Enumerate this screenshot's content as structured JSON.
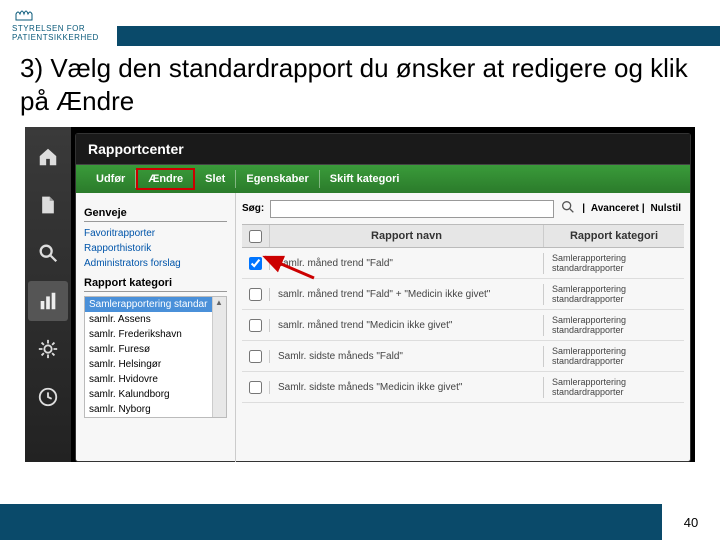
{
  "logo": {
    "line1": "STYRELSEN FOR",
    "line2": "PATIENTSIKKERHED"
  },
  "slide_title": "3) Vælg den standardrapport du ønsker at redigere og klik på Ændre",
  "panel_title": "Rapportcenter",
  "toolbar": {
    "udfor": "Udfør",
    "aendre": "Ændre",
    "slet": "Slet",
    "egenskaber": "Egenskaber",
    "skift": "Skift kategori"
  },
  "sidebar": {
    "genveje_head": "Genveje",
    "links": [
      "Favoritrapporter",
      "Rapporthistorik",
      "Administrators forslag"
    ],
    "kategori_head": "Rapport kategori",
    "categories": [
      "Samlerapportering standar",
      "samlr. Assens",
      "samlr. Frederikshavn",
      "samlr. Furesø",
      "samlr. Helsingør",
      "samlr. Hvidovre",
      "samlr. Kalundborg",
      "samlr. Nyborg"
    ]
  },
  "search": {
    "label": "Søg:",
    "advanced": "Avanceret",
    "reset": "Nulstil"
  },
  "grid": {
    "col_name": "Rapport navn",
    "col_cat": "Rapport kategori",
    "rows": [
      {
        "name": "samlr. måned trend \"Fald\"",
        "cat": "Samlerapportering standardrapporter",
        "checked": true
      },
      {
        "name": "samlr. måned trend \"Fald\" + \"Medicin ikke givet\"",
        "cat": "Samlerapportering standardrapporter",
        "checked": false
      },
      {
        "name": "samlr. måned trend \"Medicin ikke givet\"",
        "cat": "Samlerapportering standardrapporter",
        "checked": false
      },
      {
        "name": "Samlr. sidste måneds \"Fald\"",
        "cat": "Samlerapportering standardrapporter",
        "checked": false
      },
      {
        "name": "Samlr. sidste måneds \"Medicin ikke givet\"",
        "cat": "Samlerapportering standardrapporter",
        "checked": false
      }
    ]
  },
  "page_number": "40"
}
